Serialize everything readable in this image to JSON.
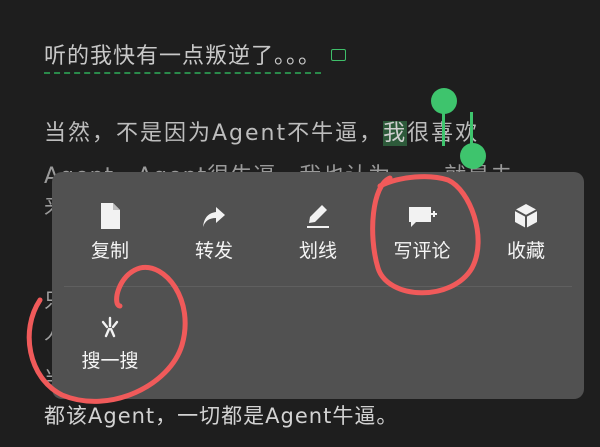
{
  "article": {
    "line1": "听的我快有一点叛逆了。。。",
    "line2_before": "当然，不是因为Agent不牛逼，",
    "line2_selected": "我",
    "line2_after": "很喜欢",
    "line3": "Agent，Agent很牛逼，我也认为，",
    "line3_tail": "就是未",
    "line4": "来",
    "side_a": "只",
    "side_b": "人",
    "side_c": "当",
    "last_line": "都该Agent，一切都是Agent牛逼。"
  },
  "menu": {
    "items": [
      {
        "label": "复制",
        "icon": "copy-icon"
      },
      {
        "label": "转发",
        "icon": "forward-icon"
      },
      {
        "label": "划线",
        "icon": "highlight-pen-icon"
      },
      {
        "label": "写评论",
        "icon": "comment-add-icon"
      },
      {
        "label": "收藏",
        "icon": "favorite-cube-icon"
      },
      {
        "label": "搜一搜",
        "icon": "search-sparkle-icon"
      }
    ]
  },
  "colors": {
    "background": "#1e1e1e",
    "menu": "#515151",
    "accent_green": "#3ec46d",
    "annotation_red": "#f05a5a"
  }
}
